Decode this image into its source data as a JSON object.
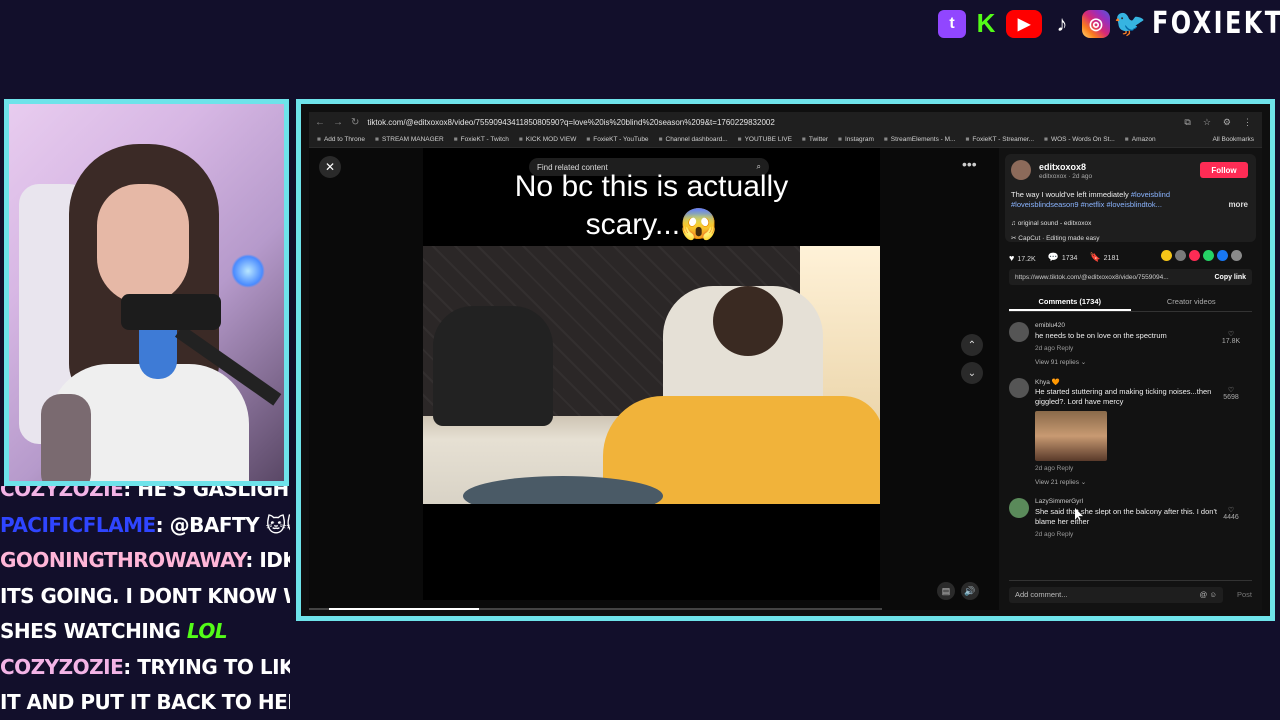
{
  "brand": {
    "name": "FOXIEKT"
  },
  "socials": [
    {
      "id": "twitch",
      "glyph": "t"
    },
    {
      "id": "kick",
      "glyph": "K"
    },
    {
      "id": "youtube",
      "glyph": "▶"
    },
    {
      "id": "tiktok",
      "glyph": "♪"
    },
    {
      "id": "instagram",
      "glyph": "◎"
    },
    {
      "id": "twitter",
      "glyph": "🐦"
    }
  ],
  "chat": {
    "lines": [
      {
        "user": "COZYZOZIE",
        "message": ": HE'S GASLIGHTING"
      },
      {
        "user": "PACIFICFLAME",
        "message": ": @BAFTY 🐱🐱"
      },
      {
        "user": "GOONINGTHROWAWAY",
        "message": ": IDK HOW"
      },
      {
        "user": "",
        "message": "ITS GOING. I DONT KNOW WHAT"
      },
      {
        "user": "",
        "message": "SHES WATCHING ",
        "extra": "LOL"
      },
      {
        "user": "COZYZOZIE",
        "message": ": TRYING TO LIKE AVOID"
      },
      {
        "user": "",
        "message": "IT AND PUT IT BACK TO HER"
      }
    ]
  },
  "browser": {
    "url": "tiktok.com/@editxoxox8/video/7559094341185080590?q=love%20is%20blind%20season%209&t=1760229832002",
    "bookmarks": [
      "Add to Throne",
      "STREAM MANAGER",
      "FoxieKT - Twitch",
      "KICK MOD VIEW",
      "FoxieKT - YouTube",
      "Channel dashboard...",
      "YOUTUBE LIVE",
      "Twitter",
      "Instagram",
      "StreamElements - M...",
      "FoxieKT - Streamer...",
      "WOS - Words On St...",
      "Amazon"
    ],
    "all_bookmarks": "All Bookmarks"
  },
  "video": {
    "search_placeholder": "Find related content",
    "caption_line1": "No bc this is actually",
    "caption_line2": "scary...😱"
  },
  "post": {
    "author": "editxoxox8",
    "author_sub": "editxoxox · 2d ago",
    "follow_label": "Follow",
    "description": "The way I would've left immediately",
    "tags": "#loveisblind #loveisblindseason9 #netflix #loveisblindtok...",
    "more_label": "more",
    "sound": "original sound - editxoxox",
    "capcut": "CapCut · Editing made easy",
    "likes": "17.2K",
    "comments_count": "1734",
    "saves": "2181",
    "share_colors": [
      "#f5c518",
      "#7a7a7a",
      "#fe2c55",
      "#25d366",
      "#1877f2",
      "#8a8a8a"
    ],
    "link": "https://www.tiktok.com/@editxoxox8/video/7559094...",
    "copy_label": "Copy link",
    "tab_comments": "Comments (1734)",
    "tab_creator": "Creator videos"
  },
  "comments": [
    {
      "user": "emiblu420",
      "text": "he needs to be on love on the spectrum",
      "meta": "2d ago    Reply",
      "replies": "View 91 replies ⌄",
      "likes": "17.8K"
    },
    {
      "user": "Khya 🧡",
      "text": "He started stuttering and making ticking noises...then giggled?. Lord have mercy",
      "meta": "2d ago    Reply",
      "replies": "View 21 replies ⌄",
      "likes": "5698"
    },
    {
      "user": "LazySimmerGyrl",
      "text": "She said that she slept on the balcony after this. I don't blame her either",
      "meta": "2d ago    Reply",
      "replies": "",
      "likes": "4446"
    }
  ],
  "add_comment": {
    "placeholder": "Add comment...",
    "post_label": "Post"
  }
}
